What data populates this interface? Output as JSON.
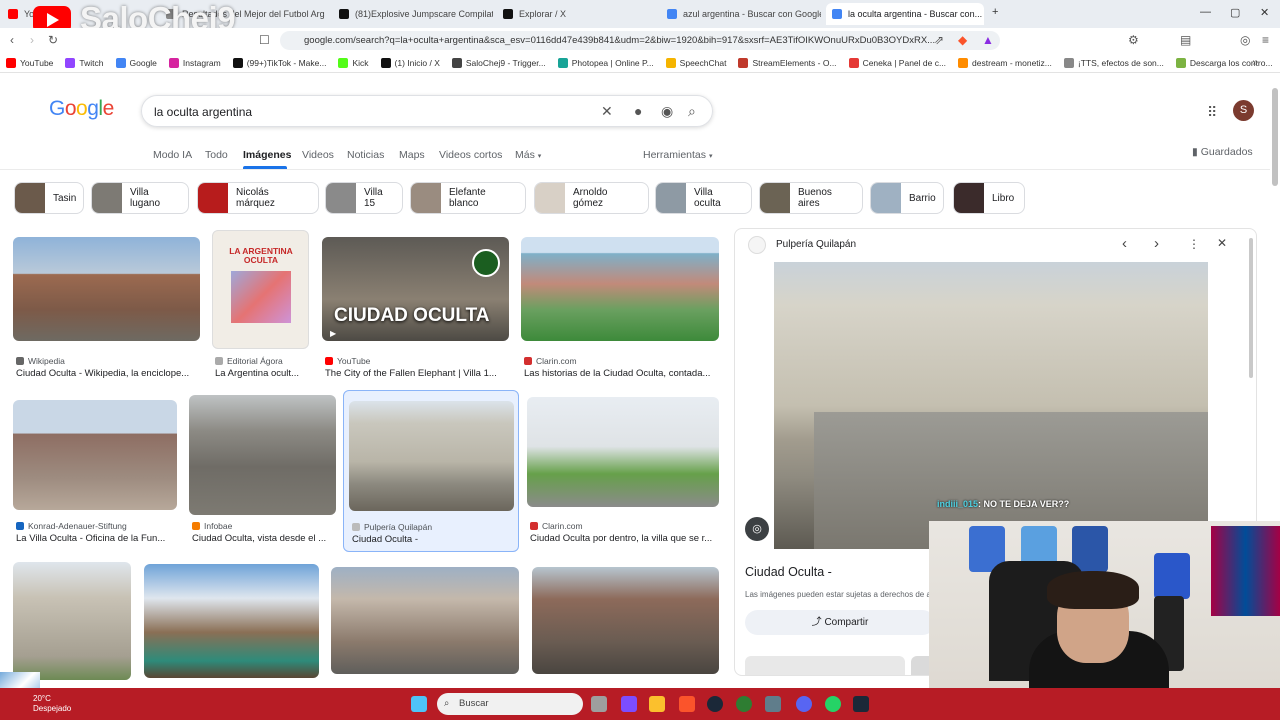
{
  "browser": {
    "tabs": [
      {
        "label": "YouTube",
        "color": "#ff0000"
      },
      {
        "label": "Resultados del Mejor del Futbol Argen...",
        "color": "#888888"
      },
      {
        "label": "(81)Explosive Jumpscare Compilation...",
        "color": "#111111"
      },
      {
        "label": "Explorar / X",
        "color": "#111111"
      },
      {
        "label": "azul argentina - Buscar con Google",
        "color": "#4285f4"
      },
      {
        "label": "la oculta argentina - Buscar con...",
        "color": "#4285f4"
      }
    ],
    "url": "google.com/search?q=la+oculta+argentina&sca_esv=0116dd47e439b841&udm=2&biw=1920&bih=917&sxsrf=AE3TifOIKWOnuURxDu0B3OYDxRX...",
    "bookmarks": [
      {
        "label": "YouTube",
        "color": "#ff0000"
      },
      {
        "label": "Twitch",
        "color": "#9146ff"
      },
      {
        "label": "Google",
        "color": "#4285f4"
      },
      {
        "label": "Instagram",
        "color": "#d6249f"
      },
      {
        "label": "(99+)TikTok - Make...",
        "color": "#111111"
      },
      {
        "label": "Kick",
        "color": "#53fc18"
      },
      {
        "label": "(1) Inicio / X",
        "color": "#111111"
      },
      {
        "label": "SaloChej9 - Trigger...",
        "color": "#444444"
      },
      {
        "label": "Photopea | Online P...",
        "color": "#18a497"
      },
      {
        "label": "SpeechChat",
        "color": "#f5b400"
      },
      {
        "label": "StreamElements - O...",
        "color": "#c0392b"
      },
      {
        "label": "Ceneka | Panel de c...",
        "color": "#e53935"
      },
      {
        "label": "destream - monetiz...",
        "color": "#ff8c00"
      },
      {
        "label": "¡TTS, efectos de son...",
        "color": "#888888"
      },
      {
        "label": "Descarga los contro...",
        "color": "#7cb342"
      }
    ]
  },
  "overlay": {
    "channel": "SaloChej9",
    "chat_user": "indiii_015",
    "chat_text": ": NO TE DEJA VER??"
  },
  "google": {
    "logo": "Google",
    "query": "la oculta argentina",
    "nav": [
      "Modo IA",
      "Todo",
      "Imágenes",
      "Videos",
      "Noticias",
      "Maps",
      "Videos cortos",
      "Más"
    ],
    "tools": "Herramientas",
    "saved": "Guardados",
    "chips": [
      "Tasin",
      "Villa lugano",
      "Nicolás márquez",
      "Villa 15",
      "Elefante blanco",
      "Arnoldo gómez",
      "Villa oculta",
      "Buenos aires",
      "Barrio",
      "Libro"
    ],
    "results": [
      {
        "source": "Wikipedia",
        "title": "Ciudad Oculta - Wikipedia, la enciclope..."
      },
      {
        "source": "Editorial Ágora",
        "title": "La Argentina ocult..."
      },
      {
        "source": "YouTube",
        "title": "The City of the Fallen Elephant | Villa 1..."
      },
      {
        "source": "Clarin.com",
        "title": "Las historias de la Ciudad Oculta, contada..."
      },
      {
        "source": "Konrad-Adenauer-Stiftung",
        "title": "La Villa Oculta - Oficina de la Fun..."
      },
      {
        "source": "Infobae",
        "title": "Ciudad Oculta, vista desde el ..."
      },
      {
        "source": "Pulpería Quilapán",
        "title": "Ciudad Oculta -"
      },
      {
        "source": "Clarin.com",
        "title": "Ciudad Oculta por dentro, la villa que se r..."
      }
    ],
    "book_cover_title": "LA ARGENTINA OCULTA",
    "video_overlay_text": "CIUDAD OCULTA",
    "panel": {
      "source": "Pulpería Quilapán",
      "caption": "Ciudad Oculta -",
      "note": "Las imágenes pueden estar sujetas a derechos de a",
      "share": "Compartir"
    }
  },
  "taskbar": {
    "temp": "20°C",
    "weather": "Despejado",
    "search": "Buscar"
  }
}
